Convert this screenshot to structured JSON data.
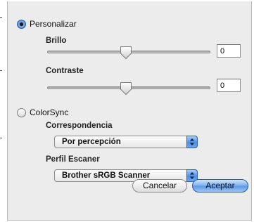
{
  "personalizar": {
    "label": "Personalizar",
    "selected": true
  },
  "brillo": {
    "label": "Brillo",
    "value": "0",
    "slider_level": 0.5
  },
  "contraste": {
    "label": "Contraste",
    "value": "0",
    "slider_level": 0.5
  },
  "colorsync": {
    "label": "ColorSync",
    "selected": false
  },
  "correspondencia": {
    "label": "Correspondencia",
    "selected": "Por percepción"
  },
  "perfil_escaner": {
    "label": "Perfil Escaner",
    "selected": "Brother sRGB Scanner"
  },
  "buttons": {
    "cancel": "Cancelar",
    "ok": "Aceptar"
  },
  "colors": {
    "accent": "#3c78d0",
    "panel": "#ececec"
  }
}
